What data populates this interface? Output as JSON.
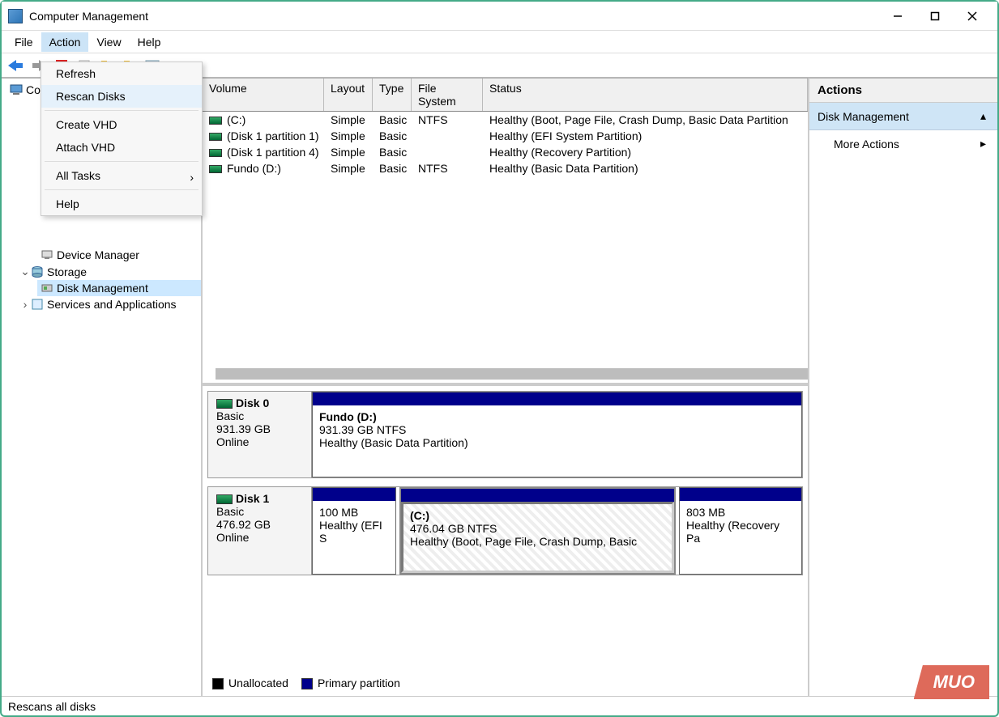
{
  "window_title": "Computer Management",
  "menubar": {
    "file": "File",
    "action": "Action",
    "view": "View",
    "help": "Help"
  },
  "context_menu": {
    "refresh": "Refresh",
    "rescan": "Rescan Disks",
    "create_vhd": "Create VHD",
    "attach_vhd": "Attach VHD",
    "all_tasks": "All Tasks",
    "help": "Help"
  },
  "tree": {
    "root_partial": "Co",
    "device_manager": "Device Manager",
    "storage": "Storage",
    "disk_management": "Disk Management",
    "services_apps": "Services and Applications"
  },
  "columns": {
    "volume": "Volume",
    "layout": "Layout",
    "type": "Type",
    "fs": "File System",
    "status": "Status"
  },
  "volumes": [
    {
      "name": "(C:)",
      "layout": "Simple",
      "type": "Basic",
      "fs": "NTFS",
      "status": "Healthy (Boot, Page File, Crash Dump, Basic Data Partition"
    },
    {
      "name": "(Disk 1 partition 1)",
      "layout": "Simple",
      "type": "Basic",
      "fs": "",
      "status": "Healthy (EFI System Partition)"
    },
    {
      "name": "(Disk 1 partition 4)",
      "layout": "Simple",
      "type": "Basic",
      "fs": "",
      "status": "Healthy (Recovery Partition)"
    },
    {
      "name": "Fundo (D:)",
      "layout": "Simple",
      "type": "Basic",
      "fs": "NTFS",
      "status": "Healthy (Basic Data Partition)"
    }
  ],
  "disks": [
    {
      "label": "Disk 0",
      "type": "Basic",
      "size": "931.39 GB",
      "state": "Online",
      "partitions": [
        {
          "title": "Fundo  (D:)",
          "line2": "931.39 GB NTFS",
          "line3": "Healthy (Basic Data Partition)",
          "flex": 1
        }
      ]
    },
    {
      "label": "Disk 1",
      "type": "Basic",
      "size": "476.92 GB",
      "state": "Online",
      "partitions": [
        {
          "title": "",
          "line2": "100 MB",
          "line3": "Healthy (EFI S",
          "flex": 0
        },
        {
          "title": "(C:)",
          "line2": "476.04 GB NTFS",
          "line3": "Healthy (Boot, Page File, Crash Dump, Basic",
          "flex": 1,
          "selected": true
        },
        {
          "title": "",
          "line2": "803 MB",
          "line3": "Healthy (Recovery Pa",
          "flex": 0
        }
      ]
    }
  ],
  "legend": {
    "unallocated": "Unallocated",
    "primary": "Primary partition"
  },
  "actions": {
    "header": "Actions",
    "dm": "Disk Management",
    "more": "More Actions"
  },
  "statusbar": "Rescans all disks",
  "watermark": "MUO"
}
